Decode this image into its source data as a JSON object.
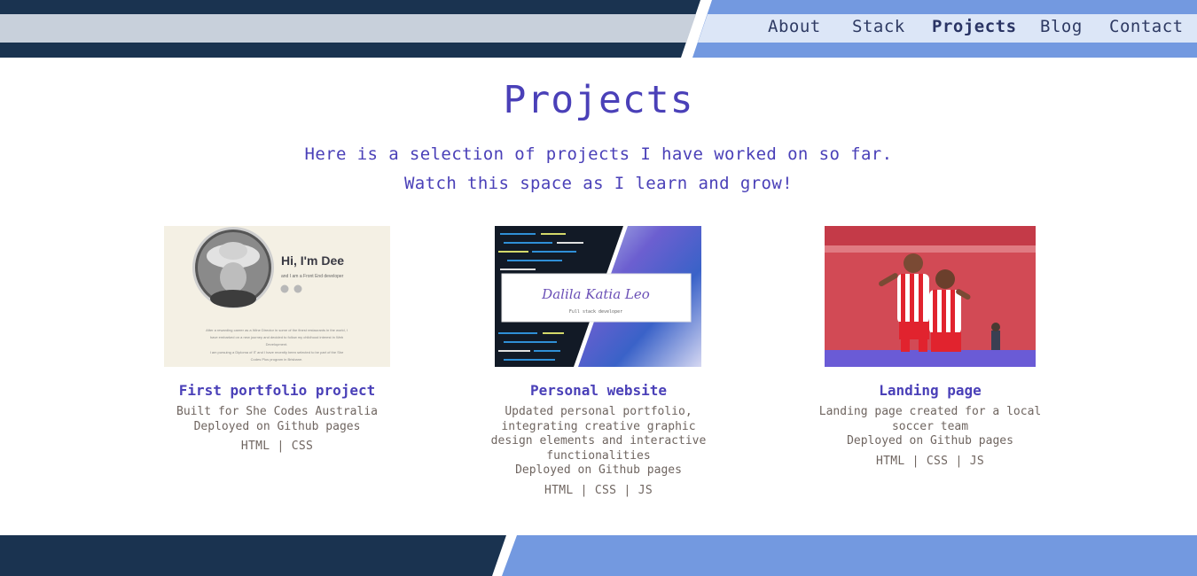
{
  "colors": {
    "navy": "#1a3350",
    "light_grey": "#c8d0db",
    "accent_blue": "#7399e0",
    "nav_bg": "#dce6f7",
    "heading_purple": "#4a40b8",
    "body_text": "#6f6560"
  },
  "nav": {
    "items": [
      {
        "label": "About"
      },
      {
        "label": "Stack"
      },
      {
        "label": "Projects"
      },
      {
        "label": "Blog"
      },
      {
        "label": "Contact"
      }
    ],
    "active": "Projects"
  },
  "main": {
    "title": "Projects",
    "intro_line1": "Here is a selection of projects I have worked on so far.",
    "intro_line2": "Watch this space as I learn and grow!"
  },
  "projects": [
    {
      "title": "First portfolio project",
      "desc_lines": [
        "Built for She Codes Australia",
        "Deployed on Github pages"
      ],
      "tech": "HTML | CSS",
      "thumb": {
        "heading": "Hi, I'm Dee",
        "sub": "and I am a Front End developer",
        "para_lines": [
          "After a rewarding career as a Wine Director in some of the finest restaurants in the world, I",
          "have embarked on a new journey and decided to follow my childhood interest in Web",
          "Development.",
          "I am pursuing a Diploma of IT and I have recently been selected to be part of the She",
          "Codes Plus program in Brisbane."
        ]
      }
    },
    {
      "title": "Personal website",
      "desc_lines": [
        "Updated personal portfolio,",
        "integrating creative graphic",
        "design elements and interactive",
        "functionalities",
        "Deployed on Github pages"
      ],
      "tech": "HTML | CSS | JS",
      "thumb": {
        "name": "Dalila Katia Leo",
        "role": "Full stack developer"
      }
    },
    {
      "title": "Landing page",
      "desc_lines": [
        "Landing page created for a local",
        "soccer team",
        "Deployed on Github pages"
      ],
      "tech": "HTML | CSS | JS"
    }
  ]
}
